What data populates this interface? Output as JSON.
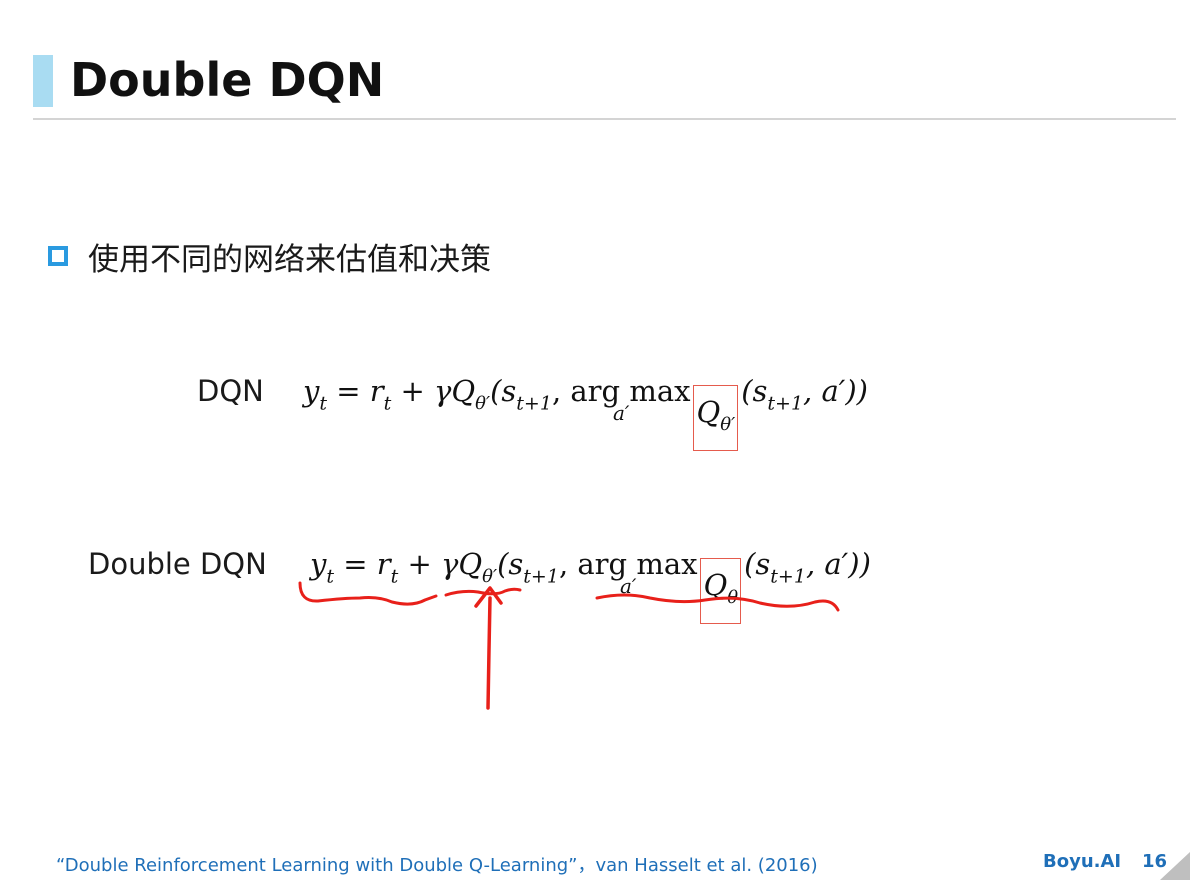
{
  "slide": {
    "title": "Double DQN",
    "bullet": "使用不同的网络来估值和决策"
  },
  "equations": [
    {
      "label": "DQN",
      "lhs": "y",
      "lhs_sub": "t",
      "eq": "=",
      "r": "r",
      "r_sub": "t",
      "plus": "+",
      "gammaQ": "γQ",
      "q1_sub": "θ′",
      "open1": "(s",
      "s1_sub": "t+1",
      "argmax": ", arg max",
      "argmax_under": "a′",
      "boxed_q": "Q",
      "boxed_sub": "θ′",
      "open2": "(s",
      "s2_sub": "t+1",
      "tail": ", a′))"
    },
    {
      "label": "Double DQN",
      "lhs": "y",
      "lhs_sub": "t",
      "eq": "=",
      "r": "r",
      "r_sub": "t",
      "plus": "+",
      "gammaQ": "γQ",
      "q1_sub": "θ′",
      "open1": "(s",
      "s1_sub": "t+1",
      "argmax": ", arg max",
      "argmax_under": "a′",
      "boxed_q": "Q",
      "boxed_sub": "θ",
      "open2": "(s",
      "s2_sub": "t+1",
      "tail": ", a′))"
    }
  ],
  "footer": {
    "citation": "“Double Reinforcement Learning with Double Q-Learning”，van Hasselt et al. (2016)",
    "brand": "Boyu.AI",
    "page": "16"
  },
  "colors": {
    "accent_bar": "#a9dcf2",
    "bullet": "#2a9ae0",
    "footer_text": "#1f6fb8",
    "annotation_ink": "#e8201a"
  }
}
